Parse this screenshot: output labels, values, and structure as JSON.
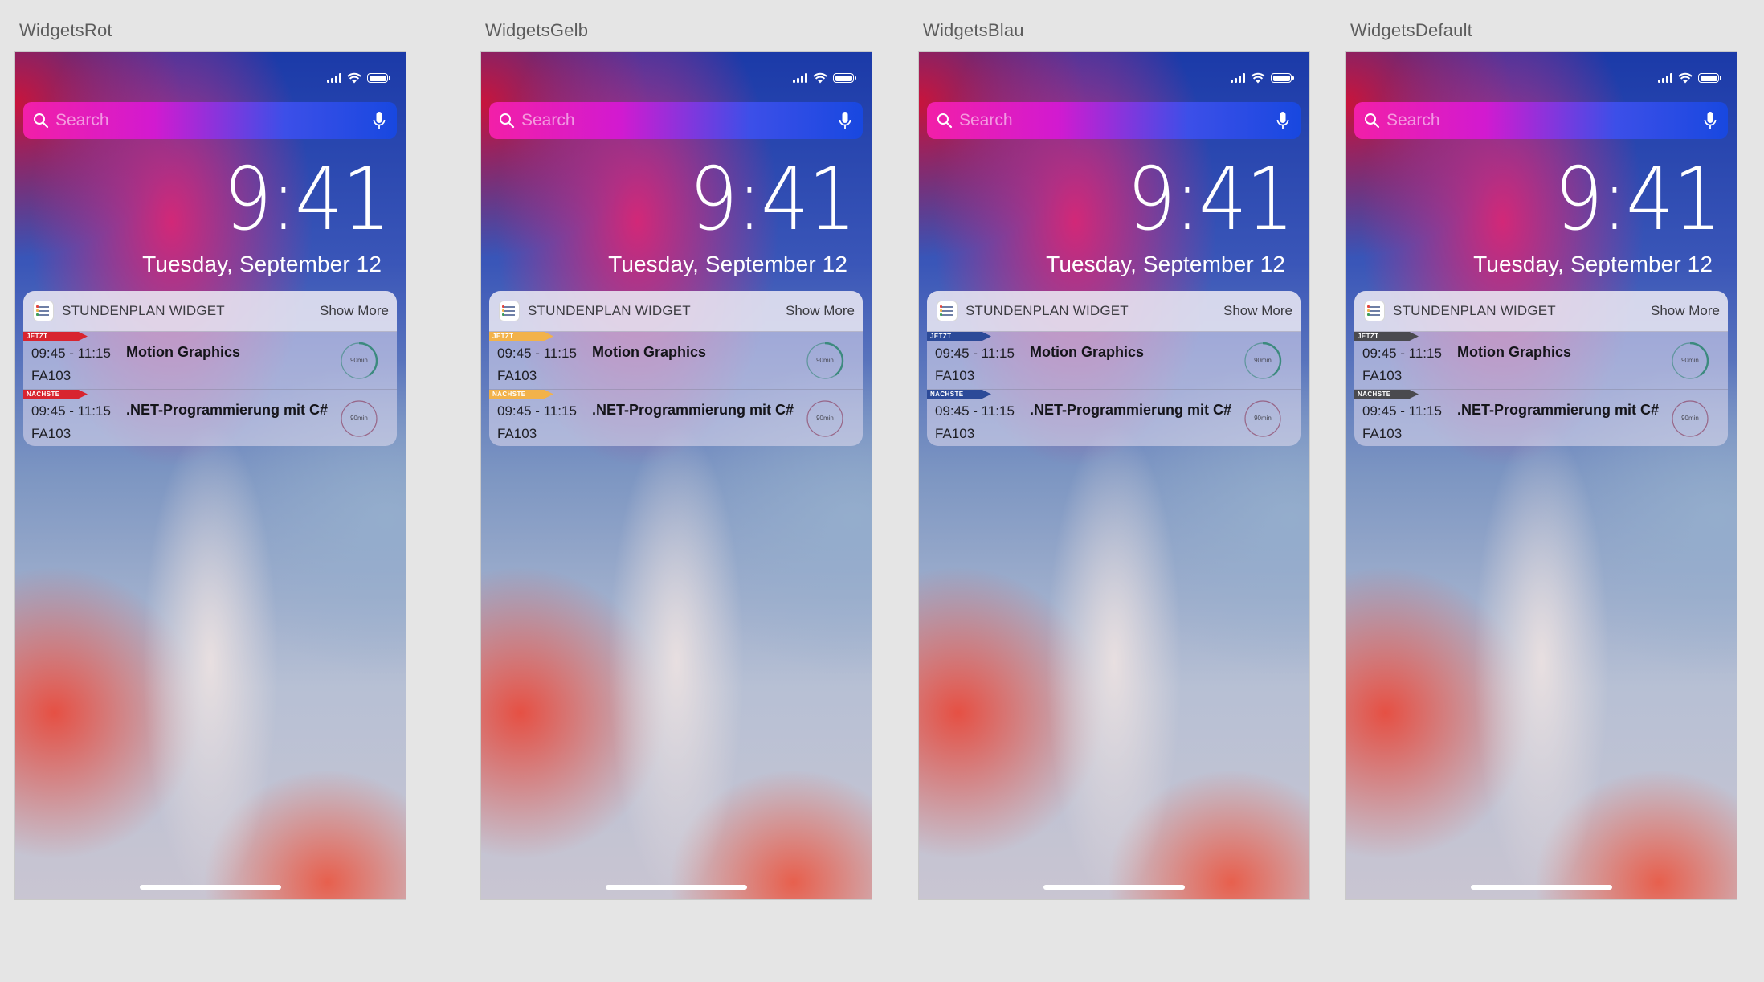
{
  "artboards": [
    {
      "title": "WidgetsRot",
      "accent": "#d8242f"
    },
    {
      "title": "WidgetsGelb",
      "accent": "#f2b24a"
    },
    {
      "title": "WidgetsBlau",
      "accent": "#2c4a98"
    },
    {
      "title": "WidgetsDefault",
      "accent": "#4a4a4f"
    }
  ],
  "lockscreen": {
    "search_placeholder": "Search",
    "time": "9:41",
    "date": "Tuesday, September 12"
  },
  "widget": {
    "app_name": "STUNDENPLAN WIDGET",
    "show_more": "Show More",
    "rows": [
      {
        "tag": "JETZT",
        "time": "09:45 - 11:15",
        "room": "FA103",
        "subject": "Motion Graphics",
        "duration": "90min",
        "ring_color": "#3c8a7e",
        "ring_progress": 0.4
      },
      {
        "tag": "NÄCHSTE",
        "time": "09:45 - 11:15",
        "room": "FA103",
        "subject": ".NET-Programmierung mit C#",
        "duration": "90min",
        "ring_color": "#8a3b5c",
        "ring_progress": 0
      }
    ]
  },
  "icons": {
    "search": "search-icon",
    "mic": "microphone-icon",
    "signal": "cellular-signal-icon",
    "wifi": "wifi-icon",
    "battery": "battery-icon",
    "app": "calendar-app-icon"
  }
}
